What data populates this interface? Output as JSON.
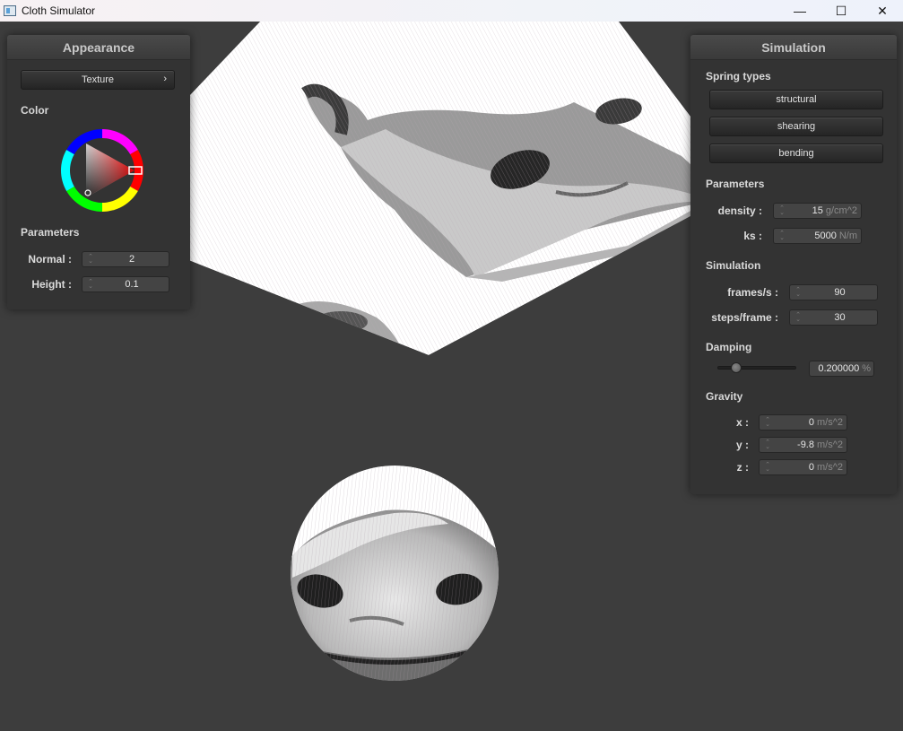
{
  "window": {
    "title": "Cloth Simulator",
    "minimize": "—",
    "maximize": "☐",
    "close": "✕"
  },
  "appearance": {
    "title": "Appearance",
    "texture_button": "Texture",
    "texture_arrow": "›",
    "color_label": "Color",
    "params_label": "Parameters",
    "normal_label": "Normal :",
    "normal_value": "2",
    "height_label": "Height :",
    "height_value": "0.1"
  },
  "simulation": {
    "title": "Simulation",
    "spring_types_label": "Spring types",
    "spring_buttons": [
      "structural",
      "shearing",
      "bending"
    ],
    "params_label": "Parameters",
    "density_label": "density :",
    "density_value": "15",
    "density_unit": "g/cm^2",
    "ks_label": "ks :",
    "ks_value": "5000",
    "ks_unit": "N/m",
    "sim_label": "Simulation",
    "fps_label": "frames/s :",
    "fps_value": "90",
    "steps_label": "steps/frame :",
    "steps_value": "30",
    "damping_label": "Damping",
    "damping_value": "0.200000",
    "damping_unit": "%",
    "damping_fraction": 0.2,
    "gravity_label": "Gravity",
    "gx_label": "x :",
    "gx_value": "0",
    "gy_label": "y :",
    "gy_value": "-9.8",
    "gz_label": "z :",
    "gz_value": "0",
    "g_unit": "m/s^2"
  },
  "icons": {
    "spin": "updown-spinner-icon",
    "color_wheel": "color-wheel-icon"
  }
}
